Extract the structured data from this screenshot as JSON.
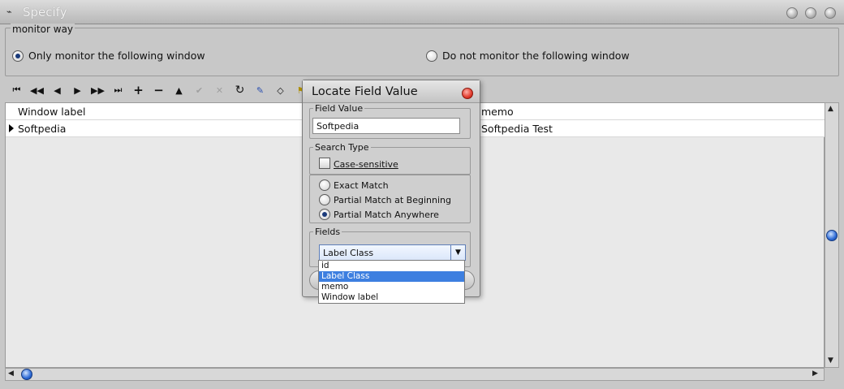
{
  "window": {
    "title": "Specify",
    "app_icon": "app-icon"
  },
  "monitor": {
    "legend": "monitor way",
    "options": [
      {
        "label": "Only monitor the following window",
        "selected": true
      },
      {
        "label": "Do not monitor the following window",
        "selected": false
      }
    ]
  },
  "toolbar": {
    "buttons": [
      "first-icon",
      "prior-page-icon",
      "prior-icon",
      "next-icon",
      "next-page-icon",
      "last-icon",
      "insert-icon",
      "delete-icon",
      "edit-icon",
      "post-icon",
      "cancel-icon",
      "refresh-icon",
      "locate-icon",
      "goto-icon",
      "filter-icon"
    ]
  },
  "grid": {
    "rows": [
      {
        "col1": "Window label",
        "col2": "memo",
        "current": false
      },
      {
        "col1": "Softpedia",
        "col2": "Softpedia Test",
        "current": true
      }
    ]
  },
  "dialog": {
    "title": "Locate Field Value",
    "field_value_legend": "Field Value",
    "field_value": "Softpedia",
    "search_type_legend": "Search Type",
    "case_sensitive": "Case-sensitive",
    "exact_match": "Exact Match",
    "partial_beginning": "Partial Match at Beginning",
    "partial_anywhere": "Partial Match Anywhere",
    "fields_legend": "Fields",
    "fields_selected": "Label Class",
    "field_options": [
      "id",
      "Label Class",
      "memo",
      "Window label"
    ]
  },
  "colors": {
    "accent": "#3d7fe0",
    "background": "#c8c8c8"
  }
}
